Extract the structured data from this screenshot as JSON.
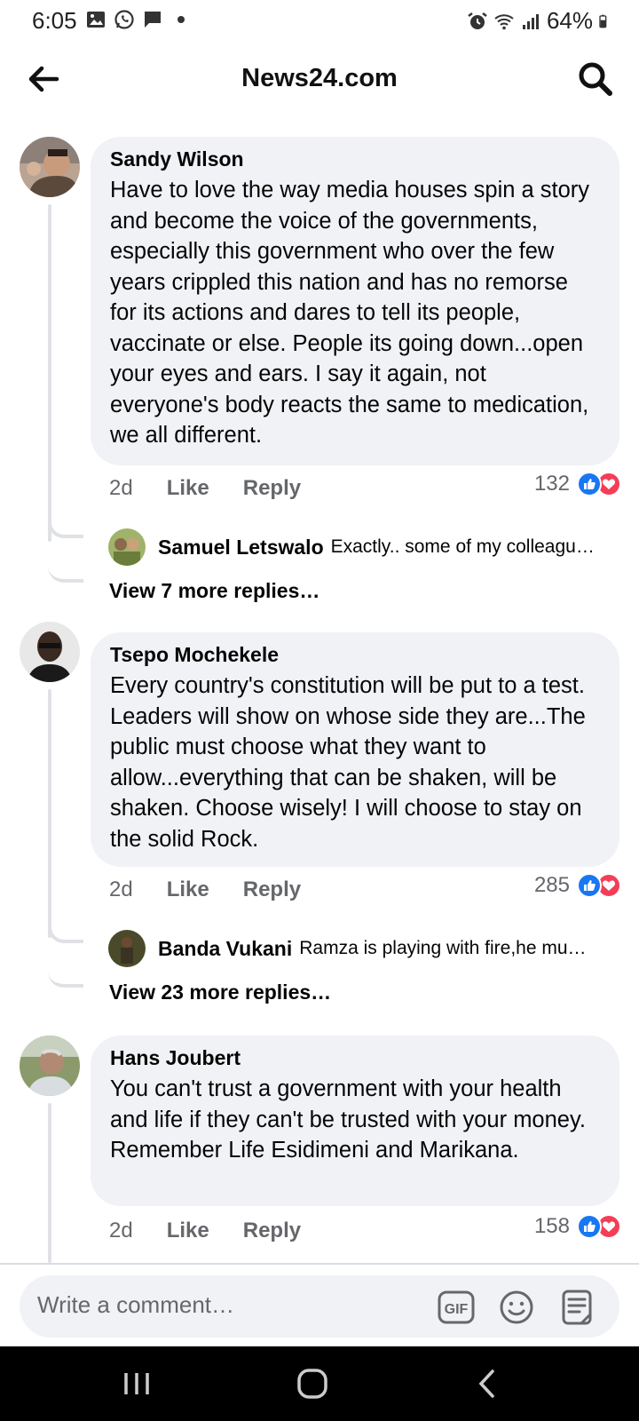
{
  "status_bar": {
    "time": "6:05",
    "battery": "64%"
  },
  "header": {
    "title": "News24.com"
  },
  "comments": [
    {
      "author": "Sandy Wilson",
      "text": "Have to love the way media houses spin a story and become the voice of the governments, especially this government who over the few years crippled this nation and has no remorse for its actions and dares to tell its people, vaccinate or else. People its going down...open your eyes and ears. I say it again, not everyone's body reacts the same to medication, we all different.",
      "age": "2d",
      "like_label": "Like",
      "reply_label": "Reply",
      "reaction_count": "132",
      "reply": {
        "author": "Samuel Letswalo",
        "text": "Exactly.. some of my colleagu…"
      },
      "view_more": "View 7 more replies…"
    },
    {
      "author": "Tsepo Mochekele",
      "text": "Every country's constitution will be put to a test. Leaders will show on whose side they are...The public must  choose what they want to allow...everything that can be shaken, will be shaken. Choose wisely! I will choose to stay on the solid Rock.",
      "age": "2d",
      "like_label": "Like",
      "reply_label": "Reply",
      "reaction_count": "285",
      "reply": {
        "author": "Banda Vukani",
        "text": "Ramza is playing with fire,he mu…"
      },
      "view_more": "View 23 more replies…"
    },
    {
      "author": "Hans Joubert",
      "text": "You can't trust a government with your health and life if they can't be trusted with your money. Remember Life Esidimeni and Marikana.",
      "age": "2d",
      "like_label": "Like",
      "reply_label": "Reply",
      "reaction_count": "158"
    }
  ],
  "composer": {
    "placeholder": "Write a comment…",
    "gif_label": "GIF"
  },
  "colors": {
    "bubble": "#f0f2f5",
    "like_blue": "#1877f2",
    "love_red": "#f33e58",
    "meta_gray": "#65676b"
  }
}
